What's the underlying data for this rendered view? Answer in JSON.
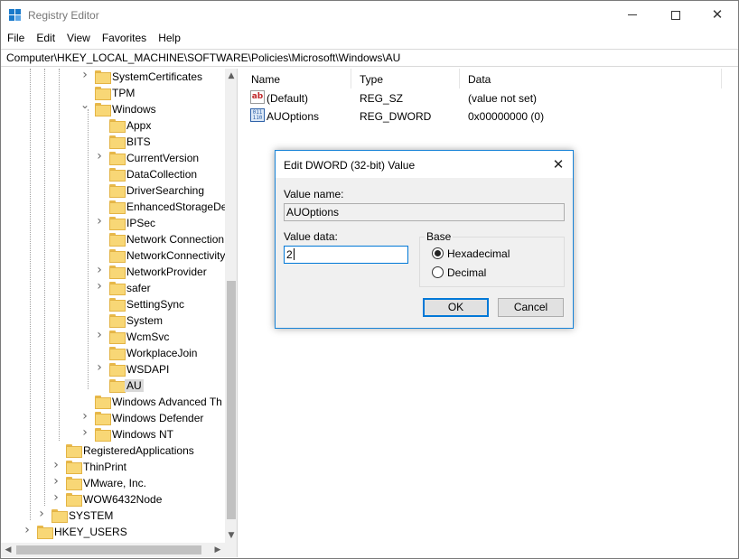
{
  "window": {
    "title": "Registry Editor",
    "controls": {
      "minimize": "minimize",
      "maximize": "maximize",
      "close": "✕"
    }
  },
  "menu": [
    "File",
    "Edit",
    "View",
    "Favorites",
    "Help"
  ],
  "address": "Computer\\HKEY_LOCAL_MACHINE\\SOFTWARE\\Policies\\Microsoft\\Windows\\AU",
  "tree": {
    "items": [
      {
        "label": "SystemCertificates",
        "depth": 3,
        "expander": "collapsed"
      },
      {
        "label": "TPM",
        "depth": 3,
        "expander": "none"
      },
      {
        "label": "Windows",
        "depth": 3,
        "expander": "expanded"
      },
      {
        "label": "Appx",
        "depth": 4,
        "expander": "none"
      },
      {
        "label": "BITS",
        "depth": 4,
        "expander": "none"
      },
      {
        "label": "CurrentVersion",
        "depth": 4,
        "expander": "collapsed"
      },
      {
        "label": "DataCollection",
        "depth": 4,
        "expander": "none"
      },
      {
        "label": "DriverSearching",
        "depth": 4,
        "expander": "none"
      },
      {
        "label": "EnhancedStorageDe",
        "depth": 4,
        "expander": "none"
      },
      {
        "label": "IPSec",
        "depth": 4,
        "expander": "collapsed"
      },
      {
        "label": "Network Connection",
        "depth": 4,
        "expander": "none"
      },
      {
        "label": "NetworkConnectivity",
        "depth": 4,
        "expander": "none"
      },
      {
        "label": "NetworkProvider",
        "depth": 4,
        "expander": "collapsed"
      },
      {
        "label": "safer",
        "depth": 4,
        "expander": "collapsed"
      },
      {
        "label": "SettingSync",
        "depth": 4,
        "expander": "none"
      },
      {
        "label": "System",
        "depth": 4,
        "expander": "none"
      },
      {
        "label": "WcmSvc",
        "depth": 4,
        "expander": "collapsed"
      },
      {
        "label": "WorkplaceJoin",
        "depth": 4,
        "expander": "none"
      },
      {
        "label": "WSDAPI",
        "depth": 4,
        "expander": "collapsed"
      },
      {
        "label": "AU",
        "depth": 4,
        "expander": "none",
        "selected": true
      },
      {
        "label": "Windows Advanced Th",
        "depth": 3,
        "expander": "none"
      },
      {
        "label": "Windows Defender",
        "depth": 3,
        "expander": "collapsed"
      },
      {
        "label": "Windows NT",
        "depth": 3,
        "expander": "collapsed"
      },
      {
        "label": "RegisteredApplications",
        "depth": 2,
        "expander": "none"
      },
      {
        "label": "ThinPrint",
        "depth": 2,
        "expander": "collapsed"
      },
      {
        "label": "VMware, Inc.",
        "depth": 2,
        "expander": "collapsed"
      },
      {
        "label": "WOW6432Node",
        "depth": 2,
        "expander": "collapsed"
      },
      {
        "label": "SYSTEM",
        "depth": 1,
        "expander": "collapsed"
      },
      {
        "label": "HKEY_USERS",
        "depth": 0,
        "expander": "collapsed"
      }
    ]
  },
  "list": {
    "columns": [
      "Name",
      "Type",
      "Data"
    ],
    "rows": [
      {
        "icon": "string-value-icon",
        "icon_text": "ab",
        "name": "(Default)",
        "type": "REG_SZ",
        "data": "(value not set)"
      },
      {
        "icon": "binary-value-icon",
        "icon_text": "011 110",
        "name": "AUOptions",
        "type": "REG_DWORD",
        "data": "0x00000000 (0)"
      }
    ]
  },
  "dialog": {
    "title": "Edit DWORD (32-bit) Value",
    "close": "✕",
    "value_name_label": "Value name:",
    "value_name": "AUOptions",
    "value_data_label": "Value data:",
    "value_data": "2",
    "base_label": "Base",
    "base_options": [
      {
        "label": "Hexadecimal",
        "checked": true
      },
      {
        "label": "Decimal",
        "checked": false
      }
    ],
    "ok": "OK",
    "cancel": "Cancel"
  },
  "colors": {
    "accent": "#0078d7",
    "folder": "#f8d776",
    "selection": "#d9d9d9"
  }
}
